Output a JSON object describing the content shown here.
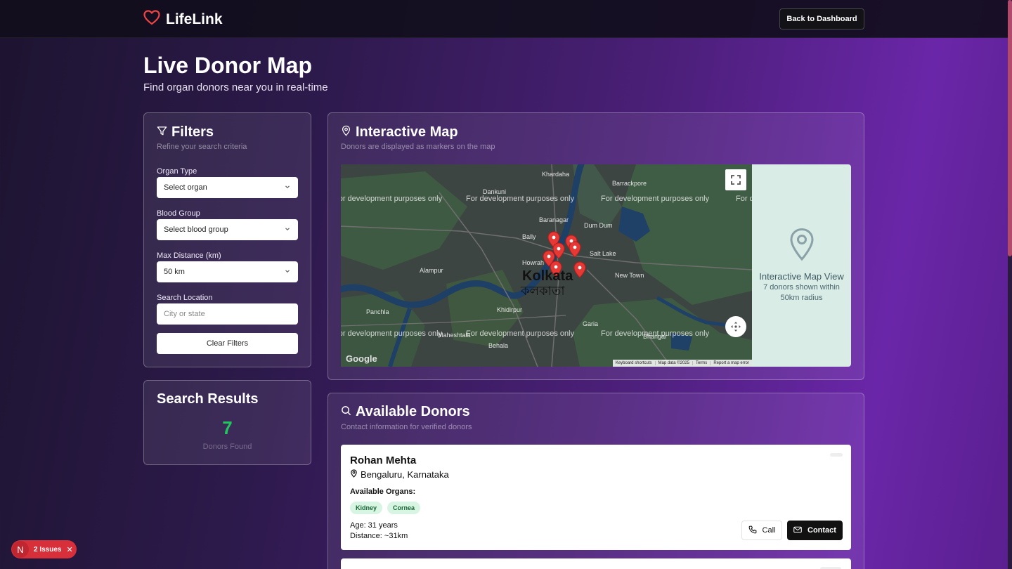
{
  "header": {
    "brand": "LifeLink",
    "back_button": "Back to Dashboard"
  },
  "page": {
    "title": "Live Donor Map",
    "subtitle": "Find organ donors near you in real-time"
  },
  "filters": {
    "title": "Filters",
    "description": "Refine your search criteria",
    "organ_label": "Organ Type",
    "organ_value": "Select organ",
    "blood_label": "Blood Group",
    "blood_value": "Select blood group",
    "distance_label": "Max Distance (km)",
    "distance_value": "50 km",
    "location_label": "Search Location",
    "location_placeholder": "City or state",
    "clear_button": "Clear Filters"
  },
  "results": {
    "title": "Search Results",
    "count": "7",
    "label": "Donors Found"
  },
  "map_card": {
    "title": "Interactive Map",
    "description": "Donors are displayed as markers on the map",
    "watermark": "For development purposes only",
    "side_title": "Interactive Map View",
    "side_text": "7 donors shown within 50km radius",
    "city": "Kolkata",
    "city_local": "কলকাতা",
    "places": [
      "Khardaha",
      "Dankuni",
      "Barrackpore",
      "Baranagar",
      "Dum Dum",
      "Bally",
      "Howrah",
      "Salt Lake",
      "Alampur",
      "New Town",
      "Panchla",
      "Khidirpur",
      "Behala",
      "Maheshtala",
      "Garia",
      "Bhangar"
    ],
    "attribution": [
      "Keyboard shortcuts",
      "Map data ©2025",
      "Terms",
      "Report a map error"
    ],
    "google": "Google"
  },
  "donors_card": {
    "title": "Available Donors",
    "description": "Contact information for verified donors",
    "donors": [
      {
        "name": "Rohan Mehta",
        "location": "Bengaluru, Karnataka",
        "organs_label": "Available Organs:",
        "organs": [
          "Kidney",
          "Cornea"
        ],
        "age": "Age: 31 years",
        "distance": "Distance: ~31km",
        "call": "Call",
        "contact": "Contact"
      }
    ]
  },
  "issues_badge": {
    "logo": "N",
    "text": "2 Issues"
  },
  "colors": {
    "accent_green": "#22c55e",
    "marker_red": "#e53935",
    "issues_red": "#d8303a"
  }
}
